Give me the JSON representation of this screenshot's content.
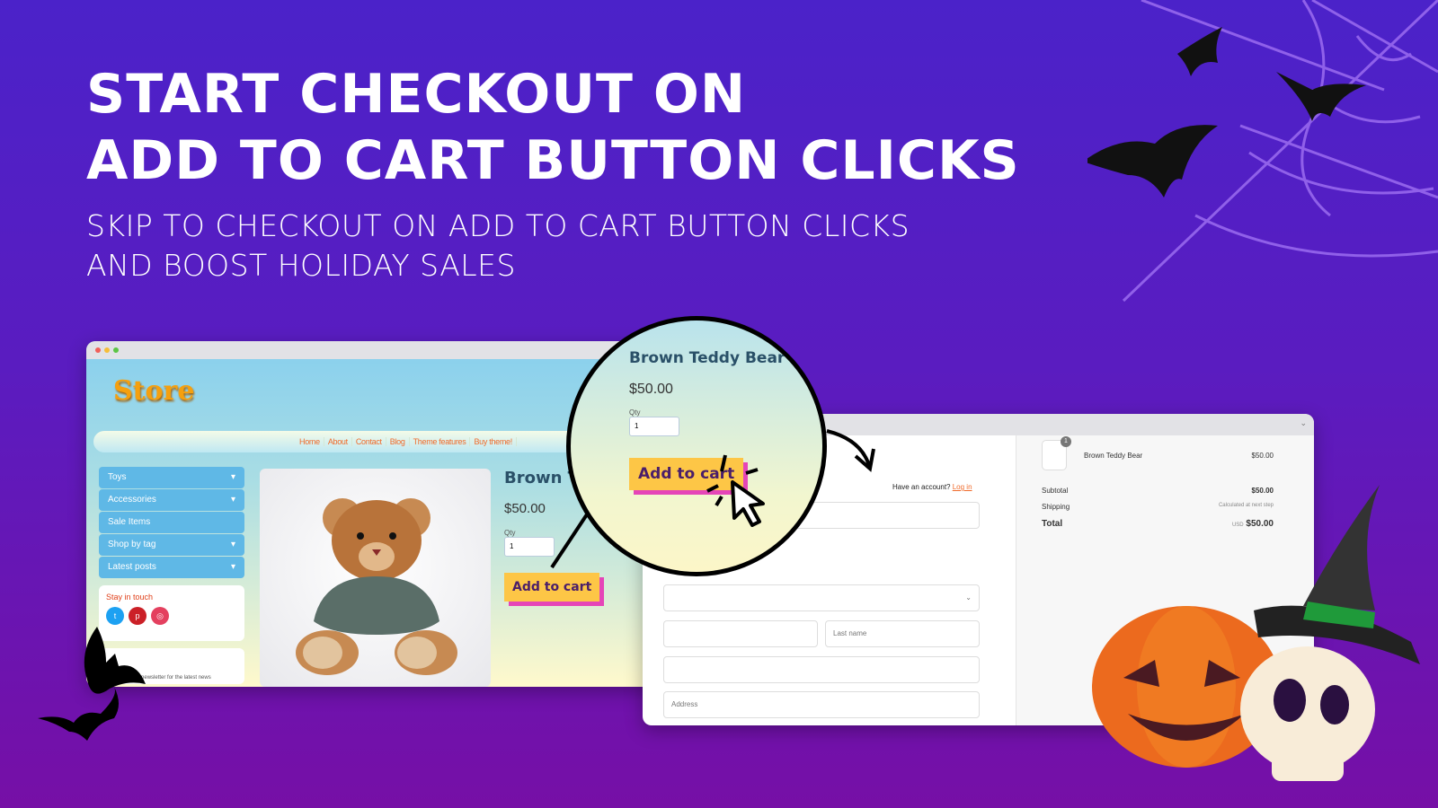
{
  "headline": {
    "line1": "START CHECKOUT ON",
    "line2": "ADD TO CART BUTTON CLICKS"
  },
  "subheadline": {
    "line1": "SKIP TO CHECKOUT ON ADD TO CART BUTTON CLICKS",
    "line2": "AND BOOST HOLIDAY SALES"
  },
  "store": {
    "logo": "Store",
    "nav": [
      "Home",
      "About",
      "Contact",
      "Blog",
      "Theme features",
      "Buy theme!"
    ],
    "sidebar": [
      {
        "label": "Toys",
        "dropdown": true
      },
      {
        "label": "Accessories",
        "dropdown": true
      },
      {
        "label": "Sale Items",
        "dropdown": false
      },
      {
        "label": "Shop by tag",
        "dropdown": true
      },
      {
        "label": "Latest posts",
        "dropdown": true
      }
    ],
    "stay_in_touch": "Stay in touch",
    "social": [
      "twitter-icon",
      "pinterest-icon",
      "instagram-icon"
    ],
    "newsletter": "Sign up to our newsletter for the latest news",
    "product_name": "Brown Teddy Bear",
    "price": "$50.00",
    "qty_label": "Qty",
    "qty_value": "1",
    "add_to_cart": "Add to cart"
  },
  "checkout": {
    "have_account": "Have an account?",
    "login": "Log in",
    "last_name": "Last name",
    "address": "Address",
    "item_count": "1",
    "item_name": "Brown Teddy Bear",
    "item_price": "$50.00",
    "subtotal_label": "Subtotal",
    "subtotal": "$50.00",
    "shipping_label": "Shipping",
    "shipping": "Calculated at next step",
    "total_label": "Total",
    "currency": "USD",
    "total": "$50.00"
  },
  "colors": {
    "accent_button": "#fdc646",
    "button_shadow": "#e545b8",
    "link": "#f06a2a"
  }
}
